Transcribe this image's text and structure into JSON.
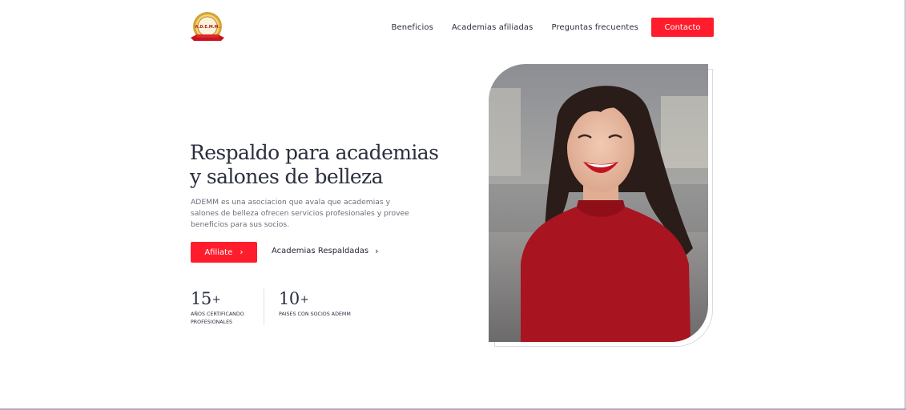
{
  "header": {
    "logo_text": "A.D.E.M.M.",
    "nav": [
      {
        "label": "Beneficios"
      },
      {
        "label": "Academias afiliadas"
      },
      {
        "label": "Preguntas frecuentes"
      }
    ],
    "contact_label": "Contacto"
  },
  "hero": {
    "title": "Respaldo para academias y salones de belleza",
    "description": "ADEMM es una asociacion que avala que academias y salones de belleza ofrecen servicios profesionales y provee beneficios para sus socios.",
    "primary_cta": "Afiliate",
    "secondary_cta": "Academias Respaldadas"
  },
  "stats": [
    {
      "number": "15",
      "plus": "+",
      "label": "AÑOS CERTIFICANDO PROFESIONALES"
    },
    {
      "number": "10",
      "plus": "+",
      "label": "PAISES CON SOCIOS ADEMM"
    }
  ],
  "colors": {
    "accent": "#ff1d2d",
    "heading": "#2b2f3f",
    "body_text": "#6b6f7b",
    "sweater": "#a8141f"
  },
  "icons": {
    "chevron": "chevron-right-icon"
  }
}
